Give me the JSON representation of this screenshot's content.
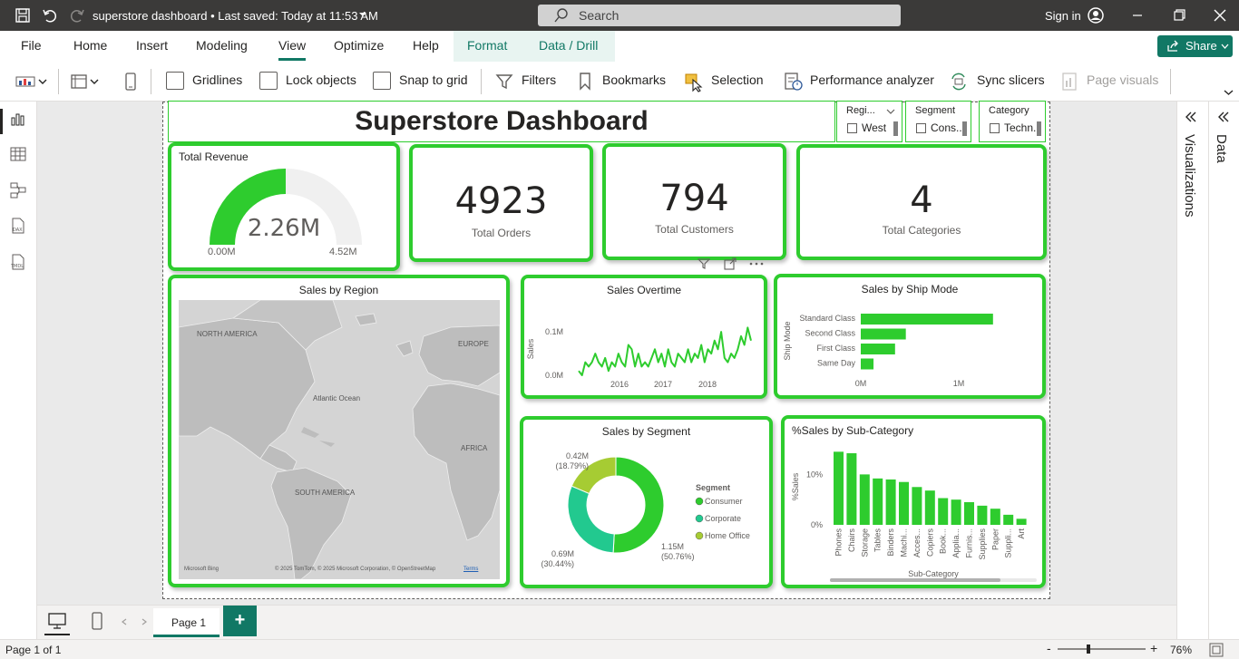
{
  "titlebar": {
    "doc_title": "superstore dashboard • Last saved: Today at 11:53 AM",
    "search_placeholder": "Search",
    "signin": "Sign in"
  },
  "ribbon": {
    "tabs": [
      "File",
      "Home",
      "Insert",
      "Modeling",
      "View",
      "Optimize",
      "Help",
      "Format",
      "Data / Drill"
    ],
    "active_tab": "View",
    "share": "Share",
    "commands": {
      "gridlines": "Gridlines",
      "lock_objects": "Lock objects",
      "snap_to_grid": "Snap to grid",
      "filters": "Filters",
      "bookmarks": "Bookmarks",
      "selection": "Selection",
      "performance_analyzer": "Performance analyzer",
      "sync_slicers": "Sync slicers",
      "page_visuals": "Page visuals"
    }
  },
  "rightpane": {
    "visualizations": "Visualizations",
    "data": "Data"
  },
  "report": {
    "title": "Superstore Dashboard",
    "slicers": [
      {
        "header": "Regi...",
        "value": "West"
      },
      {
        "header": "Segment",
        "value": "Cons..."
      },
      {
        "header": "Category",
        "value": "Techn..."
      }
    ],
    "revenue": {
      "title": "Total Revenue",
      "value": "2.26M",
      "min": "0.00M",
      "max": "4.52M",
      "fraction": 0.5
    },
    "kpis": [
      {
        "value": "4923",
        "label": "Total Orders"
      },
      {
        "value": "794",
        "label": "Total Customers"
      },
      {
        "value": "4",
        "label": "Total Categories"
      }
    ],
    "map": {
      "title": "Sales by Region",
      "labels": [
        "NORTH AMERICA",
        "EUROPE",
        "Atlantic Ocean",
        "AFRICA",
        "SOUTH AMERICA"
      ],
      "attribution": "© 2025 TomTom, © 2025 Microsoft Corporation, © OpenStreetMap",
      "terms": "Terms",
      "brand": "Microsoft Bing"
    }
  },
  "chart_data": [
    {
      "type": "line",
      "title": "Sales Overtime",
      "ylabel": "Sales",
      "yticks": [
        "0.0M",
        "0.1M"
      ],
      "xticks": [
        "2016",
        "2017",
        "2018"
      ],
      "ylim": [
        0,
        0.14
      ],
      "series": [
        {
          "values": [
            0.01,
            0.0,
            0.03,
            0.02,
            0.03,
            0.05,
            0.03,
            0.02,
            0.04,
            0.01,
            0.03,
            0.02,
            0.05,
            0.03,
            0.02,
            0.07,
            0.06,
            0.02,
            0.05,
            0.02,
            0.03,
            0.02,
            0.04,
            0.06,
            0.03,
            0.05,
            0.02,
            0.06,
            0.03,
            0.02,
            0.05,
            0.04,
            0.03,
            0.06,
            0.03,
            0.05,
            0.04,
            0.07,
            0.03,
            0.06,
            0.05,
            0.08,
            0.06,
            0.1,
            0.04,
            0.03,
            0.05,
            0.04,
            0.06,
            0.09,
            0.07,
            0.11,
            0.08
          ]
        }
      ]
    },
    {
      "type": "bar",
      "title": "Sales by Ship Mode",
      "ylabel": "Ship Mode",
      "categories": [
        "Standard Class",
        "Second Class",
        "First Class",
        "Same Day"
      ],
      "values": [
        1.35,
        0.46,
        0.35,
        0.13
      ],
      "xticks": [
        "0M",
        "1M"
      ],
      "xlim": [
        0,
        1.5
      ]
    },
    {
      "type": "pie",
      "title": "Sales by Segment",
      "legend_title": "Segment",
      "categories": [
        "Consumer",
        "Corporate",
        "Home Office"
      ],
      "values": [
        1.15,
        0.69,
        0.42
      ],
      "labels": [
        {
          "value": "1.15M",
          "pct": "(50.76%)"
        },
        {
          "value": "0.69M",
          "pct": "(30.44%)"
        },
        {
          "value": "0.42M",
          "pct": "(18.79%)"
        }
      ],
      "colors": [
        "#2ecc2e",
        "#22c98f",
        "#a6cc33"
      ]
    },
    {
      "type": "bar",
      "title": "%Sales by Sub-Category",
      "ylabel": "%Sales",
      "xlabel": "Sub-Category",
      "categories": [
        "Phones",
        "Chairs",
        "Storage",
        "Tables",
        "Binders",
        "Machi...",
        "Acces...",
        "Copiers",
        "Book...",
        "Applia...",
        "Furnis...",
        "Supplies",
        "Paper",
        "Suppli...",
        "Art"
      ],
      "values": [
        14.5,
        14.2,
        10.0,
        9.2,
        9.0,
        8.5,
        7.5,
        6.8,
        5.3,
        5.0,
        4.5,
        3.8,
        3.2,
        2.0,
        1.2
      ],
      "yticks": [
        "0%",
        "10%"
      ],
      "ylim": [
        0,
        16
      ]
    }
  ],
  "pages": {
    "tab": "Page 1",
    "add": "+"
  },
  "status": {
    "page": "Page 1 of 1",
    "zoom": "76%"
  },
  "colors": {
    "accent": "#117865",
    "visual_green": "#2ecc2e"
  }
}
